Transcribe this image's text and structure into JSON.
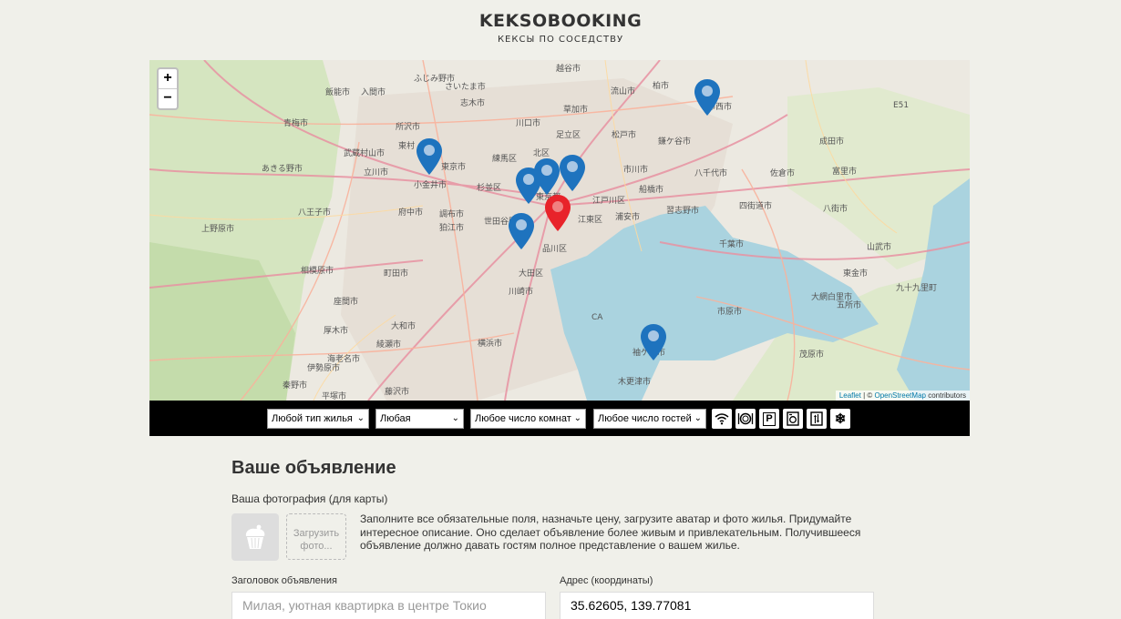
{
  "header": {
    "title": "KEKSOBOOKING",
    "subtitle": "КЕКСЫ ПО СОСЕДСТВУ"
  },
  "map": {
    "zoom_in": "+",
    "zoom_out": "−",
    "attribution_leaflet": "Leaflet",
    "attribution_sep": " | © ",
    "attribution_osm": "OpenStreetMap",
    "attribution_rest": " contributors",
    "places": [
      {
        "name": "越谷市"
      },
      {
        "name": "ふじみ野市"
      },
      {
        "name": "さいたま市"
      },
      {
        "name": "流山市"
      },
      {
        "name": "柏市"
      },
      {
        "name": "飯能市"
      },
      {
        "name": "入間市"
      },
      {
        "name": "志木市"
      },
      {
        "name": "川口市"
      },
      {
        "name": "草加市"
      },
      {
        "name": "印西市"
      },
      {
        "name": "青梅市"
      },
      {
        "name": "所沢市"
      },
      {
        "name": "足立区"
      },
      {
        "name": "松戸市"
      },
      {
        "name": "鎌ケ谷市"
      },
      {
        "name": "成田市"
      },
      {
        "name": "武蔵村山市"
      },
      {
        "name": "東村"
      },
      {
        "name": "練馬区"
      },
      {
        "name": "北区"
      },
      {
        "name": "市川市"
      },
      {
        "name": "八千代市"
      },
      {
        "name": "佐倉市"
      },
      {
        "name": "富里市"
      },
      {
        "name": "あきる野市"
      },
      {
        "name": "立川市"
      },
      {
        "name": "東京市"
      },
      {
        "name": "小金井市"
      },
      {
        "name": "杉並区"
      },
      {
        "name": "東京都"
      },
      {
        "name": "江戸川区"
      },
      {
        "name": "船橋市"
      },
      {
        "name": "八王子市"
      },
      {
        "name": "府中市"
      },
      {
        "name": "調布市"
      },
      {
        "name": "世田谷区"
      },
      {
        "name": "江東区"
      },
      {
        "name": "浦安市"
      },
      {
        "name": "習志野市"
      },
      {
        "name": "四街道市"
      },
      {
        "name": "八街市"
      },
      {
        "name": "上野原市"
      },
      {
        "name": "狛江市"
      },
      {
        "name": "品川区"
      },
      {
        "name": "千葉市"
      },
      {
        "name": "山武市"
      },
      {
        "name": "相模原市"
      },
      {
        "name": "町田市"
      },
      {
        "name": "大田区"
      },
      {
        "name": "東金市"
      },
      {
        "name": "川崎市"
      },
      {
        "name": "大網白里市"
      },
      {
        "name": "座間市"
      },
      {
        "name": "大和市"
      },
      {
        "name": "市原市"
      },
      {
        "name": "厚木市"
      },
      {
        "name": "綾瀬市"
      },
      {
        "name": "横浜市"
      },
      {
        "name": "袖ケ浦市"
      },
      {
        "name": "茂原市"
      },
      {
        "name": "海老名市"
      },
      {
        "name": "伊勢原市"
      },
      {
        "name": "木更津市"
      },
      {
        "name": "秦野市"
      },
      {
        "name": "平塚市"
      },
      {
        "name": "藤沢市"
      },
      {
        "name": "五所市"
      },
      {
        "name": "九十九里町"
      },
      {
        "name": "E51"
      },
      {
        "name": "CA"
      }
    ]
  },
  "filters": {
    "type": "Любой тип жилья",
    "price": "Любая",
    "rooms": "Любое число комнат",
    "guests": "Любое число гостей",
    "features": [
      {
        "icon": "wifi-icon",
        "label": "wifi"
      },
      {
        "icon": "dishwasher-icon",
        "label": "dishwasher"
      },
      {
        "icon": "parking-icon",
        "label": "P"
      },
      {
        "icon": "washer-icon",
        "label": "washer"
      },
      {
        "icon": "elevator-icon",
        "label": "elevator"
      },
      {
        "icon": "conditioner-icon",
        "label": "❄"
      }
    ]
  },
  "form": {
    "title": "Ваше объявление",
    "photo_label": "Ваша фотография (для карты)",
    "upload_label": "Загрузить фото...",
    "hint": "Заполните все обязательные поля, назначьте цену, загрузите аватар и фото жилья. Придумайте интересное описание. Оно сделает объявление более живым и привлекательным. Получившееся объявление должно давать гостям полное представление о вашем жилье.",
    "title_label": "Заголовок объявления",
    "title_placeholder": "Милая, уютная квартирка в центре Токио",
    "address_label": "Адрес (координаты)",
    "address_value": "35.62605, 139.77081"
  },
  "colors": {
    "background": "#f0f0ea",
    "filter_bar": "#000000",
    "pin_blue": "#1e73be",
    "pin_main": "#e8232a",
    "water": "#aad3df"
  }
}
